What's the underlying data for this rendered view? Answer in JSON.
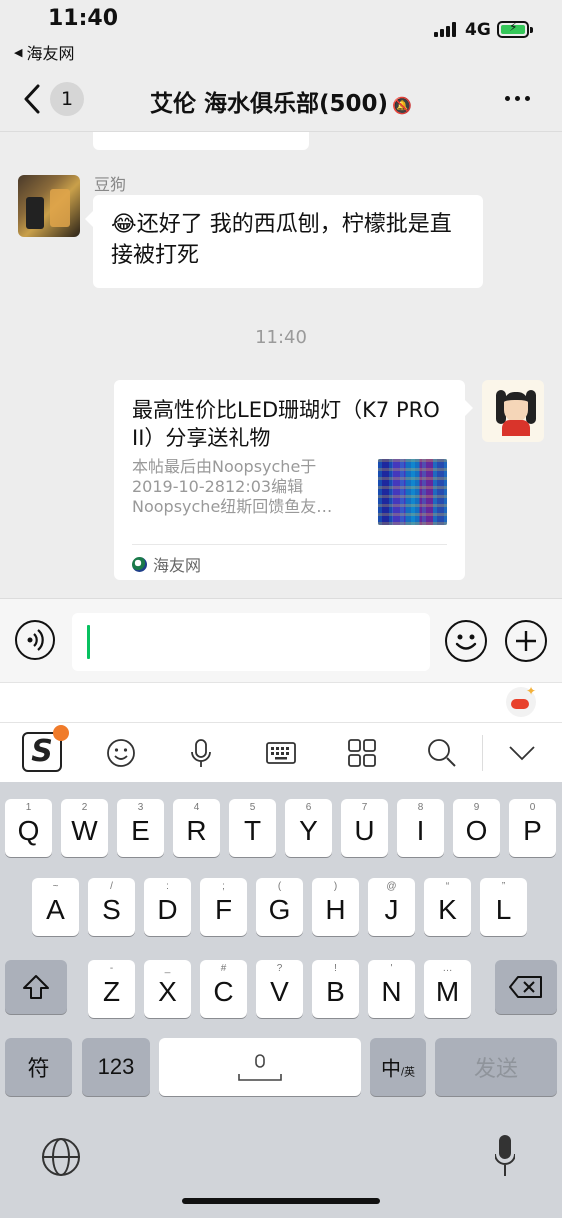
{
  "status_bar": {
    "time": "11:40",
    "back_app": "海友网",
    "network": "4G",
    "battery_level": 1.0
  },
  "nav": {
    "unread_count": "1",
    "title": "艾伦 海水俱乐部(500)",
    "muted_icon": "bell-off-icon"
  },
  "messages": {
    "sender_name": "豆狗",
    "left_text": "还好了 我的西瓜刨，柠檬批是直接被打死",
    "left_emoji": "😂",
    "timestamp": "11:40",
    "card": {
      "title": "最高性价比LED珊瑚灯（K7 PRO II）分享送礼物",
      "desc_line1": "本帖最后由Noopsyche于",
      "desc_line2": "2019-10-2812:03编辑",
      "desc_line3": "Noopsyche纽斯回馈鱼友…",
      "source": "海友网"
    }
  },
  "input": {
    "value": "",
    "accent": "#07c160"
  },
  "keyboard": {
    "row1": [
      {
        "main": "Q",
        "sub": "1"
      },
      {
        "main": "W",
        "sub": "2"
      },
      {
        "main": "E",
        "sub": "3"
      },
      {
        "main": "R",
        "sub": "4"
      },
      {
        "main": "T",
        "sub": "5"
      },
      {
        "main": "Y",
        "sub": "6"
      },
      {
        "main": "U",
        "sub": "7"
      },
      {
        "main": "I",
        "sub": "8"
      },
      {
        "main": "O",
        "sub": "9"
      },
      {
        "main": "P",
        "sub": "0"
      }
    ],
    "row2": [
      {
        "main": "A",
        "sub": "~"
      },
      {
        "main": "S",
        "sub": "/"
      },
      {
        "main": "D",
        "sub": ":"
      },
      {
        "main": "F",
        "sub": ";"
      },
      {
        "main": "G",
        "sub": "("
      },
      {
        "main": "H",
        "sub": ")"
      },
      {
        "main": "J",
        "sub": "@"
      },
      {
        "main": "K",
        "sub": "“"
      },
      {
        "main": "L",
        "sub": "”"
      }
    ],
    "row3": [
      {
        "main": "Z",
        "sub": "-"
      },
      {
        "main": "X",
        "sub": "_"
      },
      {
        "main": "C",
        "sub": "#"
      },
      {
        "main": "V",
        "sub": "?"
      },
      {
        "main": "B",
        "sub": "!"
      },
      {
        "main": "N",
        "sub": "'"
      },
      {
        "main": "M",
        "sub": "…"
      }
    ],
    "symbol_key": "符",
    "num_key": "123",
    "lang_key_main": "中",
    "lang_key_sub": "/英",
    "send_key": "发送",
    "shift_icon": "shift-icon",
    "delete_icon": "delete-icon"
  }
}
